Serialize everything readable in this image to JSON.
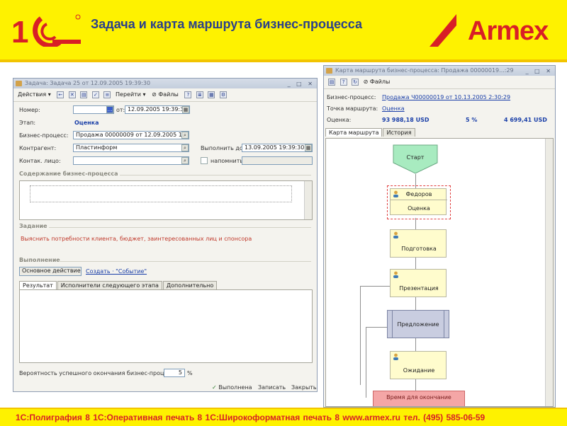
{
  "header": {
    "title": "Задача и карта маршрута бизнес-процесса",
    "brand": "Armex",
    "colors": {
      "yellow": "#fef200",
      "red": "#d81f26",
      "blue": "#2a3f8c"
    }
  },
  "footer": {
    "text": "1С:Полиграфия 8   1С:Оперативная печать 8   1С:Широкоформатная печать 8   www.armex.ru тел. (495) 585-06-59"
  },
  "task_window": {
    "title": "Задача: Задача 25 от 12.09.2005 19:39:30",
    "toolbar": {
      "actions": "Действия",
      "goto": "Перейти",
      "file": "Файлы"
    },
    "fields": {
      "number_label": "Номер:",
      "date_prefix": "от:",
      "date_value": "12.09.2005 19:39:30",
      "stage_label": "Этап:",
      "stage_value": "Оценка",
      "bp_label": "Бизнес-процесс:",
      "bp_value": "Продажа 00000009 от 12.09.2005 19:39:",
      "contragent_label": "Контрагент:",
      "contragent_value": "Пластинформ",
      "done_label": "Выполнить до:",
      "done_value": "13.09.2005 19:39:30",
      "contact_label": "Контак. лицо:",
      "remind_label": "напомнить"
    },
    "sections": {
      "content": "Содержание бизнес-процесса",
      "task": "Задание",
      "task_text": "Выяснить потребности клиента, бюджет, заинтересованных лиц и спонсора",
      "execution": "Выполнение"
    },
    "main_action": "Основное действие",
    "create_event": "Создать · \"Событие\"",
    "tabs": [
      "Результат",
      "Исполнители следующего этапа",
      "Дополнительно"
    ],
    "probability_label": "Вероятность успешного окончания бизнес-процесса:",
    "probability_value": "5",
    "probability_unit": "%",
    "buttons": {
      "complete": "Выполнена",
      "save": "Записать",
      "close": "Закрыть"
    }
  },
  "route_window": {
    "title": "Карта маршрута бизнес-процесса: Продажа 00000019...:29",
    "toolbar": {
      "file": "Файлы"
    },
    "bp_label": "Бизнес-процесс:",
    "bp_value": "Продажа Ч00000019 от 10.13.2005 2:30:29",
    "point_label": "Точка маршрута:",
    "point_value": "Оценка",
    "estimate_label": "Оценка:",
    "estimate_amount": "93 988,18 USD",
    "estimate_percent": "5 %",
    "estimate_total": "4 699,41 USD",
    "tabs": [
      "Карта маршрута",
      "История"
    ],
    "nodes": {
      "start": "Старт",
      "assignee": "Федоров",
      "evaluation": "Оценка",
      "preparation": "Подготовка",
      "presentation": "Презентация",
      "proposal": "Предложение",
      "waiting": "Ожидание",
      "end": "Время для окончание"
    }
  }
}
